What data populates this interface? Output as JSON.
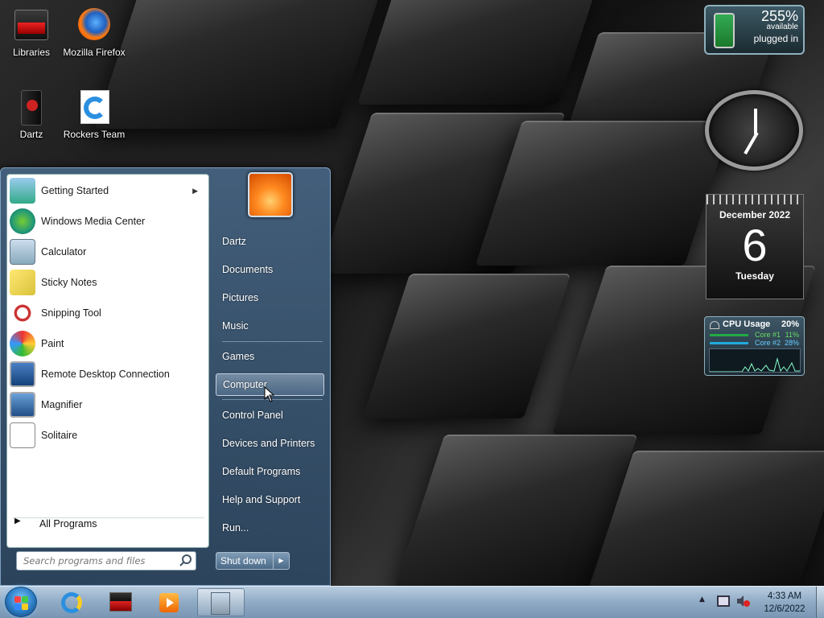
{
  "desktop": {
    "icons": [
      {
        "label": "Libraries"
      },
      {
        "label": "Mozilla Firefox"
      },
      {
        "label": "Dartz"
      },
      {
        "label": "Rockers Team"
      }
    ]
  },
  "start_menu": {
    "programs": [
      {
        "label": "Getting Started",
        "icon": "getting-started-icon",
        "has_submenu": true
      },
      {
        "label": "Windows Media Center",
        "icon": "media-center-icon"
      },
      {
        "label": "Calculator",
        "icon": "calculator-icon"
      },
      {
        "label": "Sticky Notes",
        "icon": "sticky-notes-icon"
      },
      {
        "label": "Snipping Tool",
        "icon": "snipping-tool-icon"
      },
      {
        "label": "Paint",
        "icon": "paint-icon"
      },
      {
        "label": "Remote Desktop Connection",
        "icon": "remote-desktop-icon"
      },
      {
        "label": "Magnifier",
        "icon": "magnifier-icon"
      },
      {
        "label": "Solitaire",
        "icon": "solitaire-icon"
      }
    ],
    "all_programs_label": "All Programs",
    "search_placeholder": "Search programs and files",
    "right_links": [
      {
        "label": "Dartz"
      },
      {
        "label": "Documents"
      },
      {
        "label": "Pictures"
      },
      {
        "label": "Music"
      },
      {
        "label": "Games"
      },
      {
        "label": "Computer",
        "hovered": true
      },
      {
        "label": "Control Panel"
      },
      {
        "label": "Devices and Printers"
      },
      {
        "label": "Default Programs"
      },
      {
        "label": "Help and Support"
      },
      {
        "label": "Run..."
      }
    ],
    "shutdown_label": "Shut down"
  },
  "taskbar": {
    "pinned": [
      "internet-explorer-icon",
      "libraries-icon",
      "media-player-icon",
      "active-window-icon"
    ],
    "clock_time": "4:33 AM",
    "clock_date": "12/6/2022"
  },
  "gadgets": {
    "battery": {
      "percent": "255%",
      "status1": "available",
      "status2": "plugged in"
    },
    "calendar": {
      "month_year": "December 2022",
      "day": "6",
      "weekday": "Tuesday"
    },
    "cpu": {
      "title": "CPU Usage",
      "total": "20%",
      "core1_label": "Core #1",
      "core1_value": "11%",
      "core2_label": "Core #2",
      "core2_value": "28%"
    }
  },
  "colors": {
    "accent": "#4a6a88",
    "taskbar": "#8faac4"
  }
}
